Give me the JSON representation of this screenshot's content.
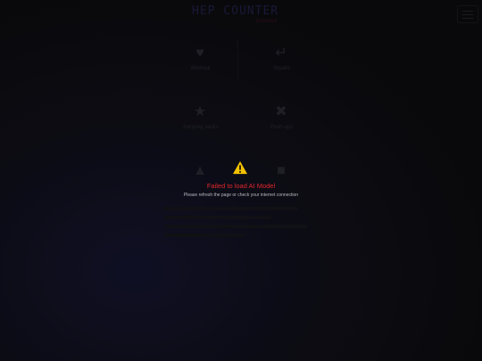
{
  "header": {
    "title": "HEP COUNTER",
    "subtitle": "powered"
  },
  "cards": [
    {
      "label": "Workout",
      "icon": "bicep-icon"
    },
    {
      "label": "Squats",
      "icon": "leg-icon"
    },
    {
      "label": "Jumping Jacks",
      "icon": "star-icon"
    },
    {
      "label": "Push-ups",
      "icon": "figure-icon"
    },
    {
      "label": "",
      "icon": "cone-icon"
    },
    {
      "label": "",
      "icon": "chat-icon"
    }
  ],
  "error": {
    "title": "Failed to load AI Model",
    "message": "Please refresh the page or check your internet connection",
    "icon": "warning-icon",
    "title_color": "#e0262a",
    "icon_color": "#f2c200"
  }
}
